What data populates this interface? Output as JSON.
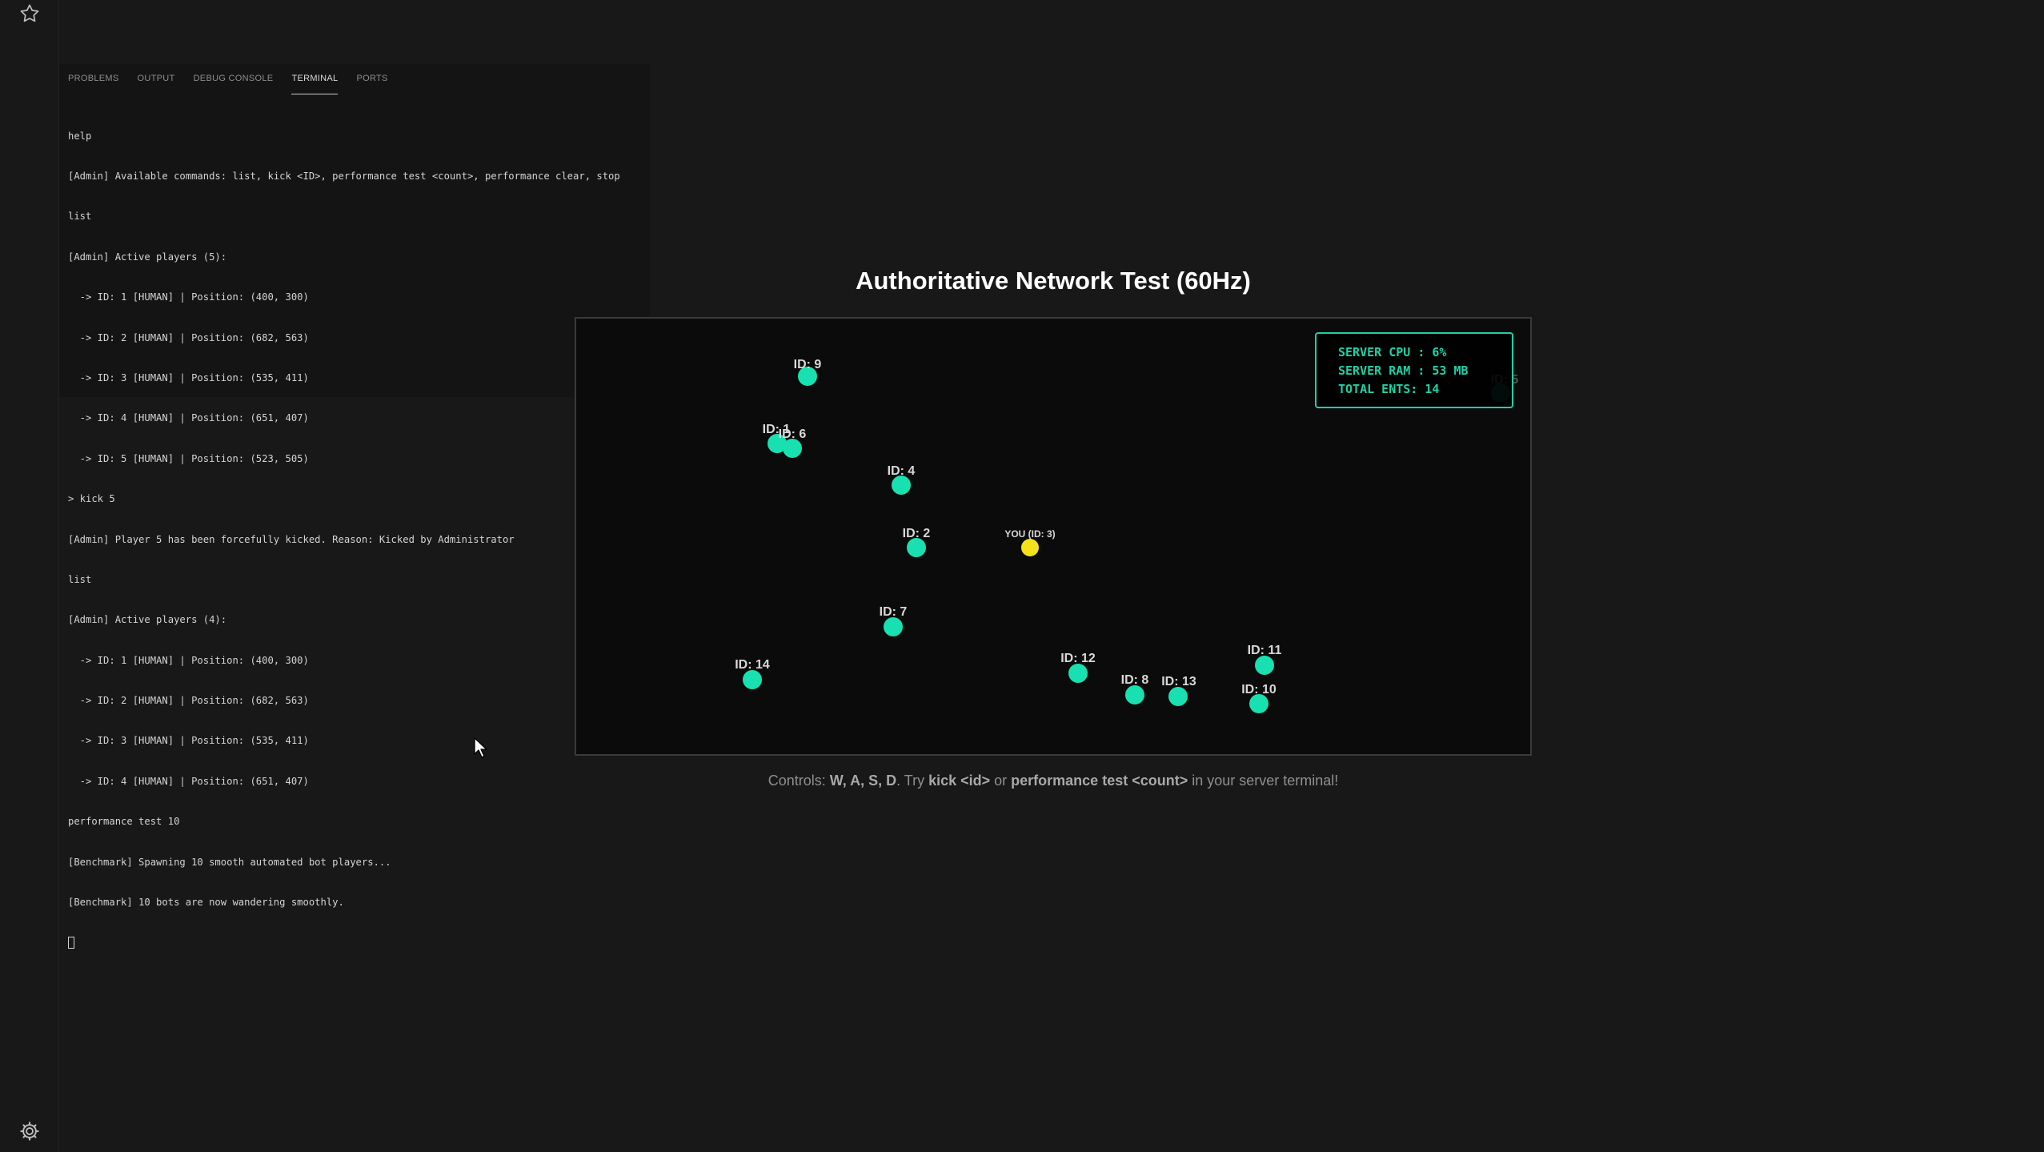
{
  "activity_bar": {
    "top_icon": "star-icon",
    "bottom_icon": "gear-icon"
  },
  "panel": {
    "tabs": [
      "PROBLEMS",
      "OUTPUT",
      "DEBUG CONSOLE",
      "TERMINAL",
      "PORTS"
    ],
    "active_tab": "TERMINAL",
    "terminal_lines": [
      "help",
      "[Admin] Available commands: list, kick <ID>, performance test <count>, performance clear, stop",
      "list",
      "[Admin] Active players (5):",
      "  -> ID: 1 [HUMAN] | Position: (400, 300)",
      "  -> ID: 2 [HUMAN] | Position: (682, 563)",
      "  -> ID: 3 [HUMAN] | Position: (535, 411)",
      "  -> ID: 4 [HUMAN] | Position: (651, 407)",
      "  -> ID: 5 [HUMAN] | Position: (523, 505)",
      "> kick 5",
      "[Admin] Player 5 has been forcefully kicked. Reason: Kicked by Administrator",
      "list",
      "[Admin] Active players (4):",
      "  -> ID: 1 [HUMAN] | Position: (400, 300)",
      "  -> ID: 2 [HUMAN] | Position: (682, 563)",
      "  -> ID: 3 [HUMAN] | Position: (535, 411)",
      "  -> ID: 4 [HUMAN] | Position: (651, 407)",
      "performance test 10",
      "[Benchmark] Spawning 10 smooth automated bot players...",
      "[Benchmark] 10 bots are now wandering smoothly."
    ]
  },
  "game": {
    "title": "Authoritative Network Test (60Hz)",
    "stats": {
      "cpu": "SERVER CPU : 6%",
      "ram": "SERVER RAM : 53 MB",
      "ents": "TOTAL ENTS: 14"
    },
    "players": [
      {
        "label": "ID: 9"
      },
      {
        "label": "ID: 1"
      },
      {
        "label": "ID: 6"
      },
      {
        "label": "ID: 4"
      },
      {
        "label": "ID: 2"
      },
      {
        "label": "YOU (ID: 3)"
      },
      {
        "label": "ID: 7"
      },
      {
        "label": "ID: 14"
      },
      {
        "label": "ID: 12"
      },
      {
        "label": "ID: 11"
      },
      {
        "label": "ID: 8"
      },
      {
        "label": "ID: 13"
      },
      {
        "label": "ID: 10"
      },
      {
        "label": "ID: 5"
      }
    ],
    "colors": {
      "bot": "#19e0b0",
      "you": "#f5e11b",
      "accent": "#1ed1a6"
    },
    "controls": {
      "prefix": "Controls: ",
      "keys": "W, A, S, D",
      "mid1": ". Try ",
      "cmd1": "kick <id>",
      "mid2": " or ",
      "cmd2": "performance test <count>",
      "suffix": " in your server terminal!"
    }
  }
}
